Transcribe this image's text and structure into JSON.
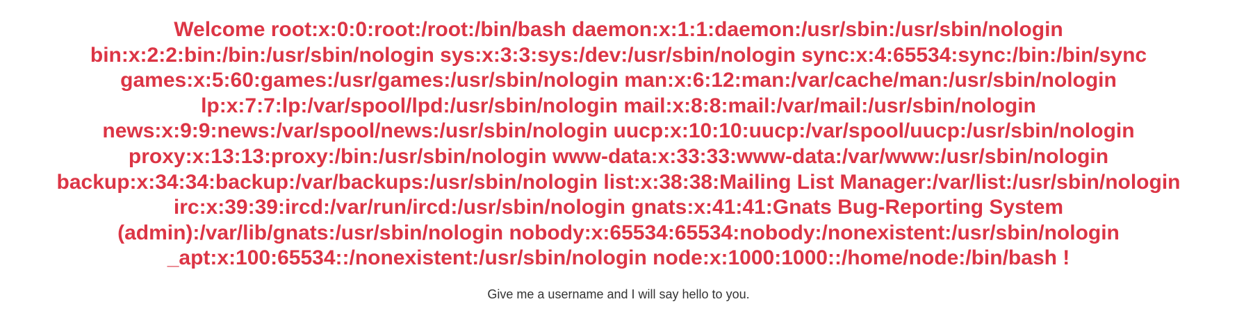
{
  "colors": {
    "greeting": "#dc3545",
    "subtitle": "#333333",
    "background": "#ffffff"
  },
  "greeting": {
    "lines": [
      "Welcome root:x:0:0:root:/root:/bin/bash daemon:x:1:1:daemon:/usr/sbin:/usr/sbin/nologin",
      "bin:x:2:2:bin:/bin:/usr/sbin/nologin sys:x:3:3:sys:/dev:/usr/sbin/nologin sync:x:4:65534:sync:/bin:/bin/sync",
      "games:x:5:60:games:/usr/games:/usr/sbin/nologin man:x:6:12:man:/var/cache/man:/usr/sbin/nologin",
      "lp:x:7:7:lp:/var/spool/lpd:/usr/sbin/nologin mail:x:8:8:mail:/var/mail:/usr/sbin/nologin",
      "news:x:9:9:news:/var/spool/news:/usr/sbin/nologin uucp:x:10:10:uucp:/var/spool/uucp:/usr/sbin/nologin",
      "proxy:x:13:13:proxy:/bin:/usr/sbin/nologin www-data:x:33:33:www-data:/var/www:/usr/sbin/nologin",
      "backup:x:34:34:backup:/var/backups:/usr/sbin/nologin list:x:38:38:Mailing List Manager:/var/list:/usr/sbin/nologin",
      "irc:x:39:39:ircd:/var/run/ircd:/usr/sbin/nologin gnats:x:41:41:Gnats Bug-Reporting System",
      "(admin):/var/lib/gnats:/usr/sbin/nologin nobody:x:65534:65534:nobody:/nonexistent:/usr/sbin/nologin",
      "_apt:x:100:65534::/nonexistent:/usr/sbin/nologin node:x:1000:1000::/home/node:/bin/bash !"
    ]
  },
  "subtitle": "Give me a username and I will say hello to you."
}
